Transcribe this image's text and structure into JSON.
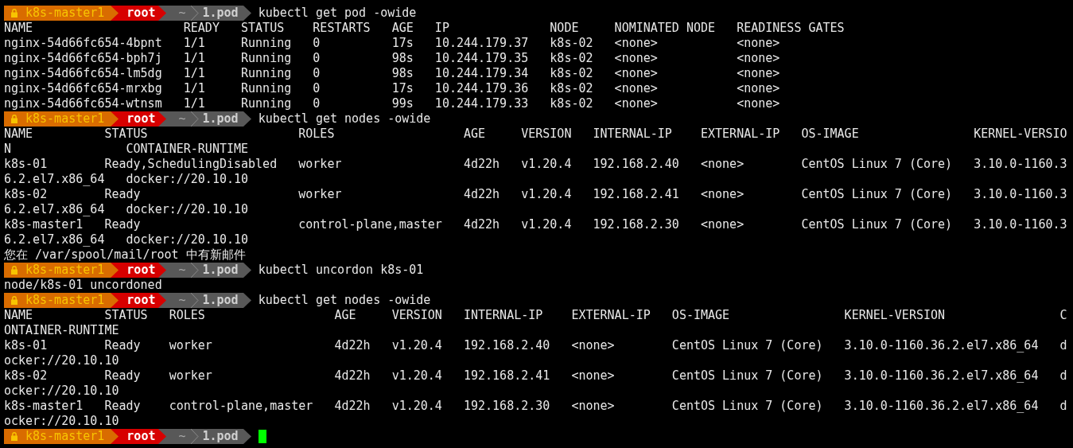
{
  "lines": [
    {
      "kind": "prompt",
      "host": "k8s-master1",
      "user": "root",
      "home": "~",
      "dir": "1.pod",
      "command": "kubectl get pod -owide",
      "cursor": false
    },
    {
      "kind": "output",
      "text": "NAME                     READY   STATUS    RESTARTS   AGE   IP              NODE     NOMINATED NODE   READINESS GATES"
    },
    {
      "kind": "output",
      "text": "nginx-54d66fc654-4bpnt   1/1     Running   0          17s   10.244.179.37   k8s-02   <none>           <none>"
    },
    {
      "kind": "output",
      "text": "nginx-54d66fc654-bph7j   1/1     Running   0          98s   10.244.179.35   k8s-02   <none>           <none>"
    },
    {
      "kind": "output",
      "text": "nginx-54d66fc654-lm5dg   1/1     Running   0          98s   10.244.179.34   k8s-02   <none>           <none>"
    },
    {
      "kind": "output",
      "text": "nginx-54d66fc654-mrxbg   1/1     Running   0          17s   10.244.179.36   k8s-02   <none>           <none>"
    },
    {
      "kind": "output",
      "text": "nginx-54d66fc654-wtnsm   1/1     Running   0          99s   10.244.179.33   k8s-02   <none>           <none>"
    },
    {
      "kind": "prompt",
      "host": "k8s-master1",
      "user": "root",
      "home": "~",
      "dir": "1.pod",
      "command": "kubectl get nodes -owide",
      "cursor": false
    },
    {
      "kind": "output",
      "text": "NAME          STATUS                     ROLES                  AGE     VERSION   INTERNAL-IP    EXTERNAL-IP   OS-IMAGE                KERNEL-VERSIO"
    },
    {
      "kind": "output",
      "text": "N                CONTAINER-RUNTIME"
    },
    {
      "kind": "output",
      "text": "k8s-01        Ready,SchedulingDisabled   worker                 4d22h   v1.20.4   192.168.2.40   <none>        CentOS Linux 7 (Core)   3.10.0-1160.3"
    },
    {
      "kind": "output",
      "text": "6.2.el7.x86_64   docker://20.10.10"
    },
    {
      "kind": "output",
      "text": "k8s-02        Ready                      worker                 4d22h   v1.20.4   192.168.2.41   <none>        CentOS Linux 7 (Core)   3.10.0-1160.3"
    },
    {
      "kind": "output",
      "text": "6.2.el7.x86_64   docker://20.10.10"
    },
    {
      "kind": "output",
      "text": "k8s-master1   Ready                      control-plane,master   4d22h   v1.20.4   192.168.2.30   <none>        CentOS Linux 7 (Core)   3.10.0-1160.3"
    },
    {
      "kind": "output",
      "text": "6.2.el7.x86_64   docker://20.10.10"
    },
    {
      "kind": "output",
      "text": "您在 /var/spool/mail/root 中有新邮件"
    },
    {
      "kind": "prompt",
      "host": "k8s-master1",
      "user": "root",
      "home": "~",
      "dir": "1.pod",
      "command": "kubectl uncordon k8s-01",
      "cursor": false
    },
    {
      "kind": "output",
      "text": "node/k8s-01 uncordoned"
    },
    {
      "kind": "prompt",
      "host": "k8s-master1",
      "user": "root",
      "home": "~",
      "dir": "1.pod",
      "command": "kubectl get nodes -owide",
      "cursor": false
    },
    {
      "kind": "output",
      "text": "NAME          STATUS   ROLES                  AGE     VERSION   INTERNAL-IP    EXTERNAL-IP   OS-IMAGE                KERNEL-VERSION                C"
    },
    {
      "kind": "output",
      "text": "ONTAINER-RUNTIME"
    },
    {
      "kind": "output",
      "text": "k8s-01        Ready    worker                 4d22h   v1.20.4   192.168.2.40   <none>        CentOS Linux 7 (Core)   3.10.0-1160.36.2.el7.x86_64   d"
    },
    {
      "kind": "output",
      "text": "ocker://20.10.10"
    },
    {
      "kind": "output",
      "text": "k8s-02        Ready    worker                 4d22h   v1.20.4   192.168.2.41   <none>        CentOS Linux 7 (Core)   3.10.0-1160.36.2.el7.x86_64   d"
    },
    {
      "kind": "output",
      "text": "ocker://20.10.10"
    },
    {
      "kind": "output",
      "text": "k8s-master1   Ready    control-plane,master   4d22h   v1.20.4   192.168.2.30   <none>        CentOS Linux 7 (Core)   3.10.0-1160.36.2.el7.x86_64   d"
    },
    {
      "kind": "output",
      "text": "ocker://20.10.10"
    },
    {
      "kind": "prompt",
      "host": "k8s-master1",
      "user": "root",
      "home": "~",
      "dir": "1.pod",
      "cursor": true
    }
  ]
}
